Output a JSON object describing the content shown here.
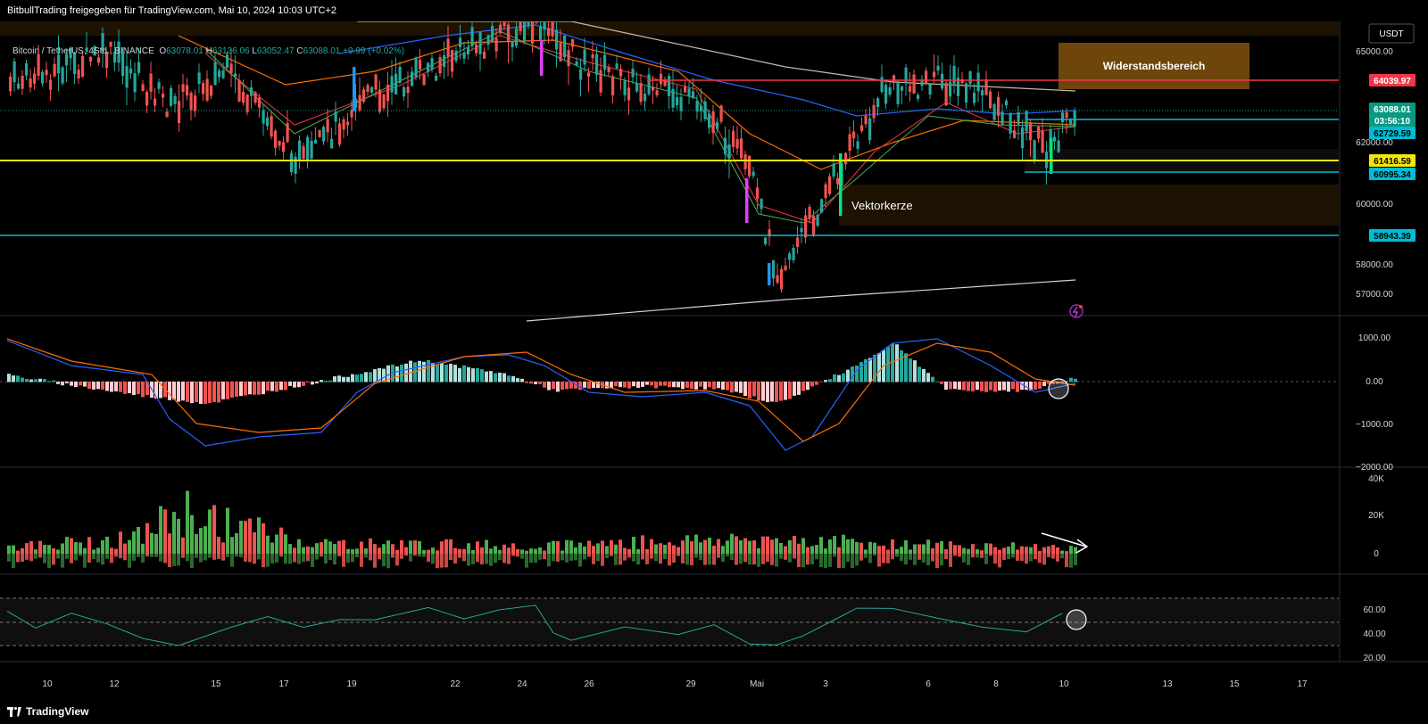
{
  "header": {
    "share_text": "BitbullTrading freigegeben für TradingView.com, Mai 10, 2024 10:03 UTC+2"
  },
  "symbol": {
    "name": "Bitcoin / TetherUS, 4Std., BINANCE",
    "open_label": "O",
    "open": "63078.01",
    "high_label": "H",
    "high": "63136.06",
    "low_label": "L",
    "low": "63052.47",
    "close_label": "C",
    "close": "63088.01",
    "change": "+9.99 (+0.02%)"
  },
  "currency_badge": "USDT",
  "price_axis": {
    "ticks": [
      "65000.00",
      "62000.00",
      "60000.00",
      "58000.00",
      "57000.00"
    ],
    "markers": [
      {
        "label": "64039.97",
        "color": "#f23645"
      },
      {
        "label": "63088.01",
        "color": "#089981"
      },
      {
        "label": "03:56:10",
        "color": "#089981"
      },
      {
        "label": "62729.59",
        "color": "#00bcd4"
      },
      {
        "label": "61416.59",
        "color": "#f5e50a"
      },
      {
        "label": "60995.34",
        "color": "#00bcd4"
      },
      {
        "label": "58943.39",
        "color": "#00bcd4"
      }
    ]
  },
  "annotations": {
    "resistance": "Widerstandsbereich",
    "vector": "Vektorkerze"
  },
  "macd_axis": [
    "1000.00",
    "0.00",
    "−1000.00",
    "−2000.00"
  ],
  "volume_axis": [
    "40K",
    "20K",
    "0"
  ],
  "rsi_axis": [
    "60.00",
    "40.00",
    "20.00"
  ],
  "time_axis": [
    "10",
    "12",
    "15",
    "17",
    "19",
    "22",
    "24",
    "26",
    "29",
    "Mai",
    "3",
    "6",
    "8",
    "10",
    "13",
    "15",
    "17"
  ],
  "footer": {
    "brand": "TradingView"
  },
  "colors": {
    "up": "#26a69a",
    "down": "#ef5350",
    "resistance_line": "#f23645",
    "support_yellow": "#f5e50a",
    "support_cyan": "#00bcd4",
    "zone": "#f59c1a"
  },
  "chart_data": [
    {
      "type": "candlestick",
      "title": "Bitcoin / TetherUS, 4Std., BINANCE",
      "ylim": [
        56500,
        66000
      ],
      "x": [
        "Apr 9",
        "Apr 10",
        "Apr 12",
        "Apr 15",
        "Apr 17",
        "Apr 19",
        "Apr 22",
        "Apr 24",
        "Apr 26",
        "Apr 29",
        "Mai 1",
        "Mai 3",
        "Mai 6",
        "Mai 8",
        "Mai 10"
      ],
      "close": [
        64500,
        61500,
        63000,
        62000,
        61000,
        63500,
        64800,
        65500,
        64000,
        63300,
        57500,
        59500,
        64000,
        61500,
        63088
      ],
      "horizontal_levels": [
        64039.97,
        62729.59,
        61416.59,
        60995.34,
        58943.39
      ],
      "zones": [
        {
          "label": "Widerstandsbereich",
          "from": 64000,
          "to": 65800
        },
        {
          "label": "Vektorkerze",
          "from": 59200,
          "to": 60500
        }
      ]
    },
    {
      "type": "bar",
      "title": "MACD",
      "ylim": [
        -2000,
        1000
      ],
      "x": [
        "Apr 10",
        "Apr 13",
        "Apr 17",
        "Apr 22",
        "Apr 24",
        "Apr 29",
        "Mai 1",
        "Mai 4",
        "Mai 6",
        "Mai 8",
        "Mai 10"
      ],
      "series": [
        {
          "values": [
            0,
            -900,
            -1200,
            150,
            300,
            -300,
            -1500,
            700,
            900,
            -150,
            -80
          ]
        },
        {
          "values": [
            -100,
            -600,
            -1100,
            100,
            400,
            -200,
            -1300,
            500,
            950,
            0,
            -100
          ]
        },
        {
          "values": [
            0,
            -300,
            -100,
            250,
            50,
            -200,
            -300,
            350,
            200,
            -100,
            50
          ]
        }
      ]
    },
    {
      "type": "bar",
      "title": "Volume",
      "ylim": [
        0,
        40000
      ],
      "x": [
        "Apr 10",
        "Apr 13",
        "Apr 17",
        "Apr 22",
        "Apr 24",
        "Apr 29",
        "Mai 1",
        "Mai 3",
        "Mai 6",
        "Mai 8",
        "Mai 10"
      ],
      "values": [
        4000,
        22000,
        6000,
        5000,
        4000,
        7000,
        9000,
        11000,
        6000,
        4000,
        3500
      ]
    },
    {
      "type": "line",
      "title": "RSI",
      "ylim": [
        10,
        75
      ],
      "x": [
        "Apr 10",
        "Apr 13",
        "Apr 17",
        "Apr 22",
        "Apr 24",
        "Apr 29",
        "Mai 1",
        "Mai 3",
        "Mai 6",
        "Mai 8",
        "Mai 10"
      ],
      "values": [
        52,
        38,
        45,
        55,
        60,
        42,
        30,
        48,
        62,
        44,
        56
      ]
    }
  ]
}
